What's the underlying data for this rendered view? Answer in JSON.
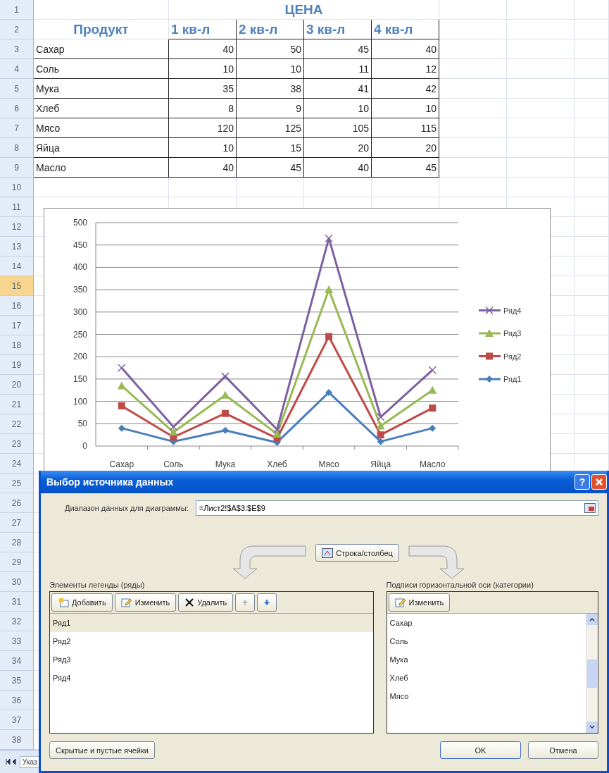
{
  "row_headers": [
    {
      "label": "1",
      "selected": false
    },
    {
      "label": "2",
      "selected": false
    },
    {
      "label": "3",
      "selected": false
    },
    {
      "label": "4",
      "selected": false
    },
    {
      "label": "5",
      "selected": false
    },
    {
      "label": "6",
      "selected": false
    },
    {
      "label": "7",
      "selected": false
    },
    {
      "label": "8",
      "selected": false
    },
    {
      "label": "9",
      "selected": false
    },
    {
      "label": "10",
      "selected": false
    },
    {
      "label": "11",
      "selected": false
    },
    {
      "label": "12",
      "selected": false
    },
    {
      "label": "13",
      "selected": false
    },
    {
      "label": "14",
      "selected": false
    },
    {
      "label": "15",
      "selected": true
    },
    {
      "label": "16",
      "selected": false
    },
    {
      "label": "17",
      "selected": false
    },
    {
      "label": "18",
      "selected": false
    },
    {
      "label": "19",
      "selected": false
    },
    {
      "label": "20",
      "selected": false
    },
    {
      "label": "21",
      "selected": false
    },
    {
      "label": "22",
      "selected": false
    },
    {
      "label": "23",
      "selected": false
    },
    {
      "label": "24",
      "selected": false
    },
    {
      "label": "25",
      "selected": false
    },
    {
      "label": "26",
      "selected": false
    },
    {
      "label": "27",
      "selected": false
    },
    {
      "label": "28",
      "selected": false
    },
    {
      "label": "29",
      "selected": false
    },
    {
      "label": "30",
      "selected": false
    },
    {
      "label": "31",
      "selected": false
    },
    {
      "label": "32",
      "selected": false
    },
    {
      "label": "33",
      "selected": false
    },
    {
      "label": "34",
      "selected": false
    },
    {
      "label": "35",
      "selected": false
    },
    {
      "label": "36",
      "selected": false
    },
    {
      "label": "37",
      "selected": false
    },
    {
      "label": "38",
      "selected": false
    }
  ],
  "table": {
    "group_header": "ЦЕНА",
    "columns": [
      "Продукт",
      "1 кв-л",
      "2 кв-л",
      "3 кв-л",
      "4 кв-л"
    ],
    "rows": [
      [
        "Сахар",
        "40",
        "50",
        "45",
        "40"
      ],
      [
        "Соль",
        "10",
        "10",
        "11",
        "12"
      ],
      [
        "Мука",
        "35",
        "38",
        "41",
        "42"
      ],
      [
        "Хлеб",
        "8",
        "9",
        "10",
        "10"
      ],
      [
        "Мясо",
        "120",
        "125",
        "105",
        "115"
      ],
      [
        "Яйца",
        "10",
        "15",
        "20",
        "20"
      ],
      [
        "Масло",
        "40",
        "45",
        "40",
        "45"
      ]
    ]
  },
  "chart": {
    "chart_data": {
      "type": "line",
      "grid": true,
      "legend": true,
      "categories": [
        "Сахар",
        "Соль",
        "Мука",
        "Хлеб",
        "Мясо",
        "Яйца",
        "Масло"
      ],
      "ylim": [
        0,
        500
      ],
      "yticks": [
        0,
        50,
        100,
        150,
        200,
        250,
        300,
        350,
        400,
        450,
        500
      ],
      "series": [
        {
          "name": "Ряд1",
          "color": "#4a7ebb",
          "marker": "diamond",
          "values": [
            40,
            10,
            35,
            8,
            120,
            10,
            40
          ]
        },
        {
          "name": "Ряд2",
          "color": "#be4b48",
          "marker": "square",
          "values": [
            90,
            20,
            73,
            17,
            245,
            25,
            85
          ]
        },
        {
          "name": "Ряд3",
          "color": "#98b954",
          "marker": "triangle",
          "values": [
            135,
            31,
            114,
            27,
            350,
            45,
            125
          ]
        },
        {
          "name": "Ряд4",
          "color": "#7d60a0",
          "marker": "x",
          "values": [
            175,
            43,
            156,
            37,
            465,
            65,
            170
          ]
        }
      ]
    }
  },
  "dialog": {
    "title": "Выбор источника данных",
    "help_button": "?",
    "range_label": "Диапазон данных для диаграммы:",
    "range_value": "=Лист2!$A$3:$E$9",
    "switch_button": "Строка/столбец",
    "legend_section": {
      "label": "Элементы легенды (ряды)",
      "buttons": [
        "Добавить",
        "Изменить",
        "Удалить"
      ],
      "items": [
        {
          "label": "Ряд1",
          "selected": true
        },
        {
          "label": "Ряд2",
          "selected": false
        },
        {
          "label": "Ряд3",
          "selected": false
        },
        {
          "label": "Ряд4",
          "selected": false
        }
      ]
    },
    "axis_section": {
      "label": "Подписи горизонтальной оси (категории)",
      "button": "Изменить",
      "items": [
        "Сахар",
        "Соль",
        "Мука",
        "Хлеб",
        "Мясо"
      ]
    },
    "hidden_cells_button": "Скрытые и пустые ячейки",
    "ok_button": "OK",
    "cancel_button": "Отмена"
  },
  "sheet_tab": "Указ"
}
